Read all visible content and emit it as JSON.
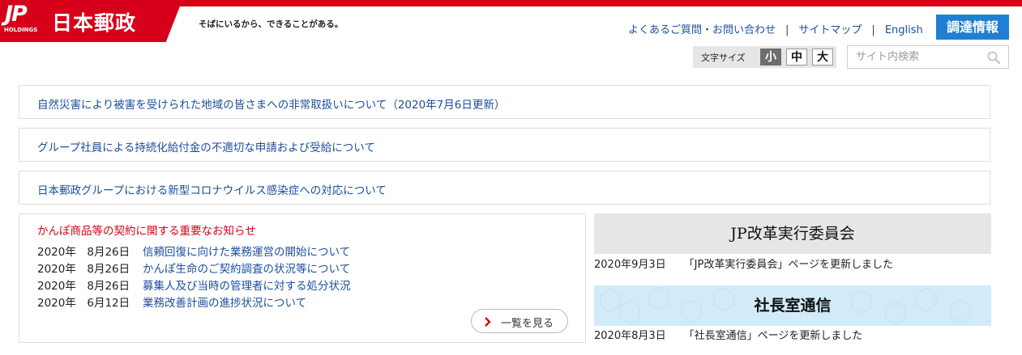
{
  "header": {
    "logo_mark": "JP",
    "logo_sub": "HOLDINGS",
    "brand": "日本郵政",
    "tagline": "そばにいるから、できることがある。",
    "nav": [
      {
        "label": "よくあるご質問・お問い合わせ"
      },
      {
        "label": "サイトマップ"
      },
      {
        "label": "English"
      }
    ],
    "procure_label": "調達情報",
    "fontsize_label": "文字サイズ",
    "fontsize_options": [
      "小",
      "中",
      "大"
    ],
    "fontsize_selected": "小",
    "search_placeholder": "サイト内検索"
  },
  "notices": [
    {
      "label": "自然災害により被害を受けられた地域の皆さまへの非常取扱いについて（2020年7月6日更新）"
    },
    {
      "label": "グループ社員による持続化給付金の不適切な申請および受給について"
    },
    {
      "label": "日本郵政グループにおける新型コロナウイルス感染症への対応について"
    }
  ],
  "kampo": {
    "title": "かんぽ商品等の契約に関する重要なお知らせ",
    "items": [
      {
        "date": "2020年　8月26日",
        "title": "信頼回復に向けた業務運営の開始について"
      },
      {
        "date": "2020年　8月26日",
        "title": "かんぽ生命のご契約調査の状況等について"
      },
      {
        "date": "2020年　8月26日",
        "title": "募集人及び当時の管理者に対する処分状況"
      },
      {
        "date": "2020年　6月12日",
        "title": "業務改善計画の進捗状況について"
      }
    ],
    "more_label": "一覧を見る"
  },
  "panels": {
    "jp_reform": {
      "title": "JP改革実行委員会",
      "date": "2020年9月3日",
      "text": "「JP改革実行委員会」ページを更新しました"
    },
    "president": {
      "title": "社長室通信",
      "date": "2020年8月3日",
      "text": "「社長室通信」ページを更新しました"
    }
  },
  "colors": {
    "brand_red": "#d7001a",
    "link_blue": "#1a4f9c",
    "procure_blue": "#1f7fd3"
  }
}
